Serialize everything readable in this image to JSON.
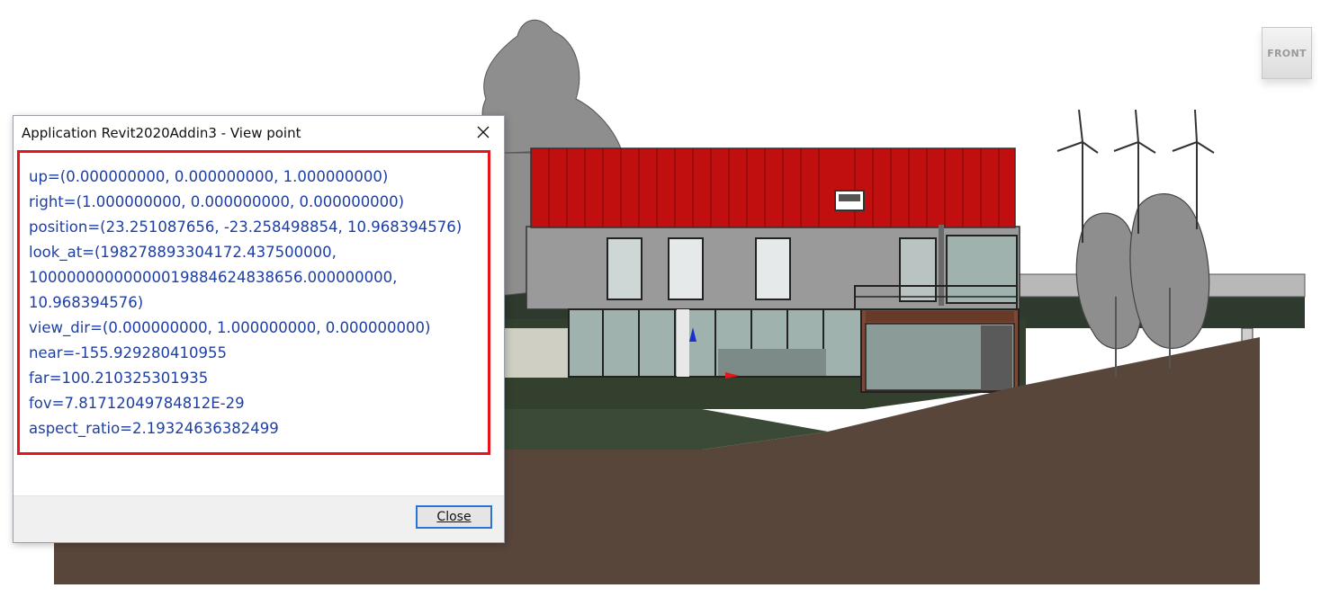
{
  "viewport": {
    "viewcube_label": "FRONT",
    "colors": {
      "roof": "#c10e0e",
      "wall": "#9a9a9a",
      "terrain": "#58463b",
      "trees": "#8e8e8e",
      "glass": "#9fb2ae",
      "wood": "#7a4a36"
    }
  },
  "dialog": {
    "title": "Application Revit2020Addin3 - View point",
    "close_icon": "close-icon",
    "lines": [
      "up=(0.000000000, 0.000000000, 1.000000000)",
      "right=(1.000000000, 0.000000000, 0.000000000)",
      "position=(23.251087656, -23.258498854, 10.968394576)",
      "look_at=(198278893304172.437500000,",
      "10000000000000019884624838656.000000000,",
      "10.968394576)",
      "view_dir=(0.000000000, 1.000000000, 0.000000000)",
      "near=-155.929280410955",
      "far=100.210325301935",
      "fov=7.81712049784812E-29",
      "aspect_ratio=2.19324636382499"
    ],
    "close_button_label": "Close",
    "highlight_color": "#e8141c",
    "text_color": "#1f3fa0"
  }
}
